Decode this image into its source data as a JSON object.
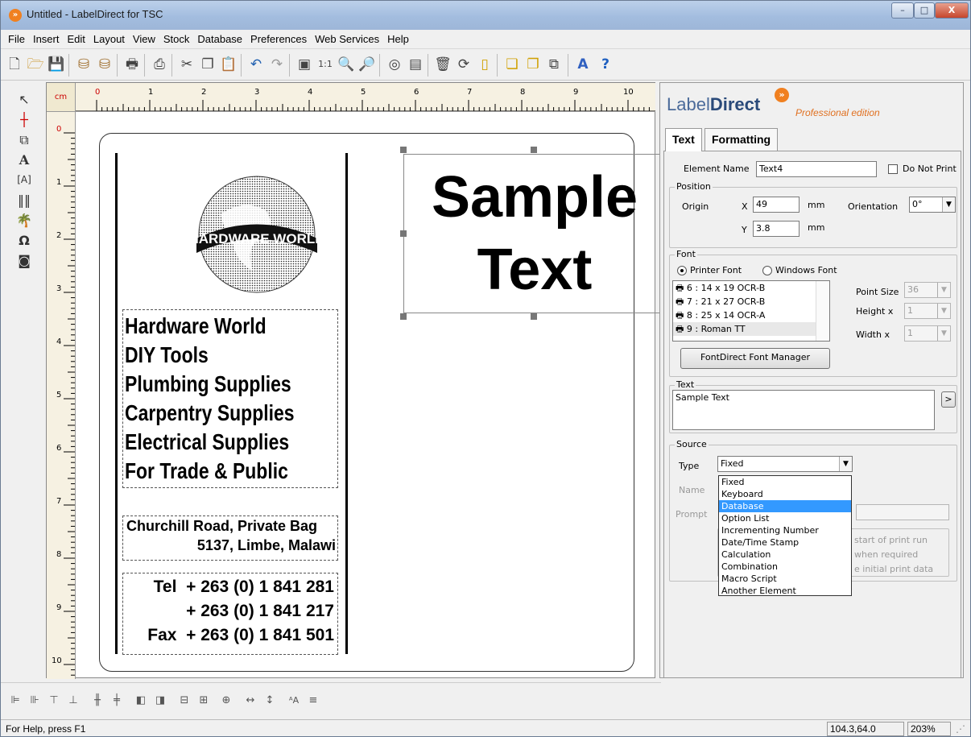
{
  "window": {
    "title": "Untitled - LabelDirect for TSC",
    "app_icon": "labeldirect-logo-icon",
    "min": "–",
    "max": "□",
    "close": "X"
  },
  "menu": [
    "File",
    "Insert",
    "Edit",
    "Layout",
    "View",
    "Stock",
    "Database",
    "Preferences",
    "Web Services",
    "Help"
  ],
  "ruler": {
    "unit": "cm",
    "h": [
      "0",
      "1",
      "2",
      "3",
      "4",
      "5",
      "6",
      "7",
      "8",
      "9",
      "10"
    ],
    "v": [
      "0",
      "1",
      "2",
      "3",
      "4",
      "5",
      "6",
      "7",
      "8",
      "9",
      "10"
    ]
  },
  "label": {
    "globe_text": "HARDWARE WORLD",
    "lines1": [
      "Hardware World",
      "DIY Tools",
      "Plumbing Supplies",
      "Carpentry Supplies",
      "Electrical Supplies",
      "For Trade & Public"
    ],
    "address": [
      "Churchill Road, Private Bag",
      "5137, Limbe, Malawi"
    ],
    "phone": [
      "Tel  + 263 (0) 1 841 281",
      "+ 263 (0) 1 841 217",
      "Fax  + 263 (0) 1 841 501"
    ],
    "sample": [
      "Sample",
      "Text"
    ]
  },
  "status": {
    "help": "For Help, press F1",
    "coords": "104.3,64.0",
    "zoom": "203%"
  },
  "panel": {
    "brand_light": "Label",
    "brand_bold": "Direct",
    "brand_logo": "»",
    "edition": "Professional edition",
    "tabs": [
      "Text",
      "Formatting"
    ],
    "element_name_label": "Element Name",
    "element_name": "Text4",
    "do_not_print": "Do Not Print",
    "position": {
      "title": "Position",
      "origin": "Origin",
      "x_label": "X",
      "x": "49",
      "y_label": "Y",
      "y": "3.8",
      "unit": "mm",
      "orientation_label": "Orientation",
      "orientation": "0°"
    },
    "font": {
      "title": "Font",
      "printer_font": "Printer Font",
      "windows_font": "Windows Font",
      "list": [
        "6 : 14 x 19 OCR-B",
        "7 : 21 x 27 OCR-B",
        "8 : 25 x 14 OCR-A",
        "9 : Roman TT"
      ],
      "point_size_label": "Point Size",
      "point_size": "36",
      "height_label": "Height x",
      "height": "1",
      "width_label": "Width x",
      "width": "1",
      "manager_button": "FontDirect Font Manager"
    },
    "text": {
      "title": "Text",
      "value": "Sample Text",
      "expand": ">"
    },
    "source": {
      "title": "Source",
      "type_label": "Type",
      "type": "Fixed",
      "name_label": "Name",
      "prompt_label": "Prompt",
      "options": [
        "Fixed",
        "Keyboard",
        "Database",
        "Option List",
        "Incrementing Number",
        "Date/Time Stamp",
        "Calculation",
        "Combination",
        "Macro Script",
        "Another Element"
      ],
      "selected_index": 2,
      "hidden_options": [
        "start of print run",
        "when required",
        "e initial print data"
      ]
    }
  }
}
